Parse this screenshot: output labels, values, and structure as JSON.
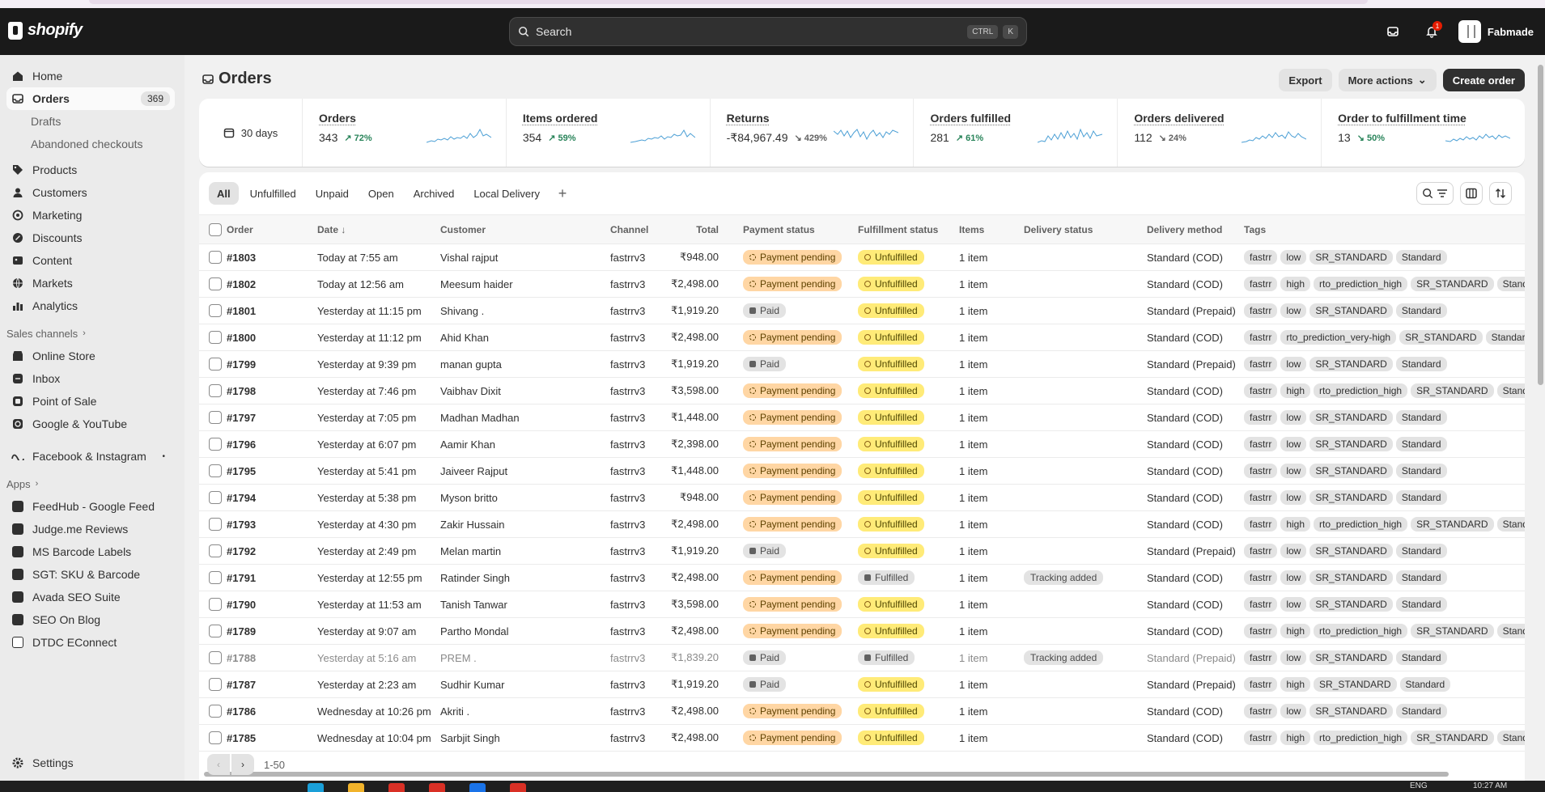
{
  "topbar": {
    "logo": "shopify",
    "search_placeholder": "Search",
    "kbd_ctrl": "CTRL",
    "kbd_k": "K",
    "notification_count": "1",
    "store_name": "Fabmade"
  },
  "sidebar": {
    "items": [
      {
        "label": "Home",
        "icon": "home-icon"
      },
      {
        "label": "Orders",
        "icon": "orders-icon",
        "count": "369"
      },
      {
        "label": "Products",
        "icon": "tag-icon"
      },
      {
        "label": "Customers",
        "icon": "person-icon"
      },
      {
        "label": "Marketing",
        "icon": "target-icon"
      },
      {
        "label": "Discounts",
        "icon": "discount-icon"
      },
      {
        "label": "Content",
        "icon": "content-icon"
      },
      {
        "label": "Markets",
        "icon": "globe-icon"
      },
      {
        "label": "Analytics",
        "icon": "chart-icon"
      }
    ],
    "orders_sub": [
      "Drafts",
      "Abandoned checkouts"
    ],
    "sales_channels_label": "Sales channels",
    "channels": [
      "Online Store",
      "Inbox",
      "Point of Sale",
      "Google & YouTube"
    ],
    "facebook": "Facebook & Instagram",
    "apps_label": "Apps",
    "apps": [
      "FeedHub - Google Feed",
      "Judge.me Reviews",
      "MS Barcode Labels",
      "SGT: SKU & Barcode",
      "Avada SEO Suite",
      "SEO On Blog",
      "DTDC EConnect"
    ],
    "settings": "Settings"
  },
  "page": {
    "title": "Orders",
    "export": "Export",
    "more_actions": "More actions",
    "create_order": "Create order"
  },
  "stats": {
    "range": "30 days",
    "cards": [
      {
        "title": "Orders",
        "value": "343",
        "delta": "72%",
        "dir": "up"
      },
      {
        "title": "Items ordered",
        "value": "354",
        "delta": "59%",
        "dir": "up"
      },
      {
        "title": "Returns",
        "value": "-₹84,967.49",
        "delta": "429%",
        "dir": "down"
      },
      {
        "title": "Orders fulfilled",
        "value": "281",
        "delta": "61%",
        "dir": "up"
      },
      {
        "title": "Orders delivered",
        "value": "112",
        "delta": "24%",
        "dir": "down"
      },
      {
        "title": "Order to fulfillment time",
        "value": "13",
        "delta": "50%",
        "dir": "down-green"
      }
    ]
  },
  "tabs": [
    "All",
    "Unfulfilled",
    "Unpaid",
    "Open",
    "Archived",
    "Local Delivery"
  ],
  "table": {
    "headers": [
      "Order",
      "Date ↓",
      "Customer",
      "Channel",
      "Total",
      "Payment status",
      "Fulfillment status",
      "Items",
      "Delivery status",
      "Delivery method",
      "Tags"
    ],
    "rows": [
      {
        "order": "#1803",
        "date": "Today at 7:55 am",
        "customer": "Vishal rajput",
        "channel": "fastrrv3",
        "total": "₹948.00",
        "payment": "Payment pending",
        "fulfillment": "Unfulfilled",
        "items": "1 item",
        "delivery": "",
        "method": "Standard (COD)",
        "tags": [
          "fastrr",
          "low",
          "SR_STANDARD",
          "Standard"
        ]
      },
      {
        "order": "#1802",
        "date": "Today at 12:56 am",
        "customer": "Meesum haider",
        "channel": "fastrrv3",
        "total": "₹2,498.00",
        "payment": "Payment pending",
        "fulfillment": "Unfulfilled",
        "items": "1 item",
        "delivery": "",
        "method": "Standard (COD)",
        "tags": [
          "fastrr",
          "high",
          "rto_prediction_high",
          "SR_STANDARD",
          "Standard"
        ]
      },
      {
        "order": "#1801",
        "date": "Yesterday at 11:15 pm",
        "customer": "Shivang .",
        "channel": "fastrrv3",
        "total": "₹1,919.20",
        "payment": "Paid",
        "fulfillment": "Unfulfilled",
        "items": "1 item",
        "delivery": "",
        "method": "Standard (Prepaid)",
        "tags": [
          "fastrr",
          "low",
          "SR_STANDARD",
          "Standard"
        ]
      },
      {
        "order": "#1800",
        "date": "Yesterday at 11:12 pm",
        "customer": "Ahid Khan",
        "channel": "fastrrv3",
        "total": "₹2,498.00",
        "payment": "Payment pending",
        "fulfillment": "Unfulfilled",
        "items": "1 item",
        "delivery": "",
        "method": "Standard (COD)",
        "tags": [
          "fastrr",
          "rto_prediction_very-high",
          "SR_STANDARD",
          "Standard"
        ]
      },
      {
        "order": "#1799",
        "date": "Yesterday at 9:39 pm",
        "customer": "manan gupta",
        "channel": "fastrrv3",
        "total": "₹1,919.20",
        "payment": "Paid",
        "fulfillment": "Unfulfilled",
        "items": "1 item",
        "delivery": "",
        "method": "Standard (Prepaid)",
        "tags": [
          "fastrr",
          "low",
          "SR_STANDARD",
          "Standard"
        ]
      },
      {
        "order": "#1798",
        "date": "Yesterday at 7:46 pm",
        "customer": "Vaibhav Dixit",
        "channel": "fastrrv3",
        "total": "₹3,598.00",
        "payment": "Payment pending",
        "fulfillment": "Unfulfilled",
        "items": "1 item",
        "delivery": "",
        "method": "Standard (COD)",
        "tags": [
          "fastrr",
          "high",
          "rto_prediction_high",
          "SR_STANDARD",
          "Standard"
        ]
      },
      {
        "order": "#1797",
        "date": "Yesterday at 7:05 pm",
        "customer": "Madhan Madhan",
        "channel": "fastrrv3",
        "total": "₹1,448.00",
        "payment": "Payment pending",
        "fulfillment": "Unfulfilled",
        "items": "1 item",
        "delivery": "",
        "method": "Standard (COD)",
        "tags": [
          "fastrr",
          "low",
          "SR_STANDARD",
          "Standard"
        ]
      },
      {
        "order": "#1796",
        "date": "Yesterday at 6:07 pm",
        "customer": "Aamir Khan",
        "channel": "fastrrv3",
        "total": "₹2,398.00",
        "payment": "Payment pending",
        "fulfillment": "Unfulfilled",
        "items": "1 item",
        "delivery": "",
        "method": "Standard (COD)",
        "tags": [
          "fastrr",
          "low",
          "SR_STANDARD",
          "Standard"
        ]
      },
      {
        "order": "#1795",
        "date": "Yesterday at 5:41 pm",
        "customer": "Jaiveer Rajput",
        "channel": "fastrrv3",
        "total": "₹1,448.00",
        "payment": "Payment pending",
        "fulfillment": "Unfulfilled",
        "items": "1 item",
        "delivery": "",
        "method": "Standard (COD)",
        "tags": [
          "fastrr",
          "low",
          "SR_STANDARD",
          "Standard"
        ]
      },
      {
        "order": "#1794",
        "date": "Yesterday at 5:38 pm",
        "customer": "Myson britto",
        "channel": "fastrrv3",
        "total": "₹948.00",
        "payment": "Payment pending",
        "fulfillment": "Unfulfilled",
        "items": "1 item",
        "delivery": "",
        "method": "Standard (COD)",
        "tags": [
          "fastrr",
          "low",
          "SR_STANDARD",
          "Standard"
        ]
      },
      {
        "order": "#1793",
        "date": "Yesterday at 4:30 pm",
        "customer": "Zakir Hussain",
        "channel": "fastrrv3",
        "total": "₹2,498.00",
        "payment": "Payment pending",
        "fulfillment": "Unfulfilled",
        "items": "1 item",
        "delivery": "",
        "method": "Standard (COD)",
        "tags": [
          "fastrr",
          "high",
          "rto_prediction_high",
          "SR_STANDARD",
          "Standard"
        ]
      },
      {
        "order": "#1792",
        "date": "Yesterday at 2:49 pm",
        "customer": "Melan martin",
        "channel": "fastrrv3",
        "total": "₹1,919.20",
        "payment": "Paid",
        "fulfillment": "Unfulfilled",
        "items": "1 item",
        "delivery": "",
        "method": "Standard (Prepaid)",
        "tags": [
          "fastrr",
          "low",
          "SR_STANDARD",
          "Standard"
        ]
      },
      {
        "order": "#1791",
        "date": "Yesterday at 12:55 pm",
        "customer": "Ratinder Singh",
        "channel": "fastrrv3",
        "total": "₹2,498.00",
        "payment": "Payment pending",
        "fulfillment": "Fulfilled",
        "items": "1 item",
        "delivery": "Tracking added",
        "method": "Standard (COD)",
        "tags": [
          "fastrr",
          "low",
          "SR_STANDARD",
          "Standard"
        ]
      },
      {
        "order": "#1790",
        "date": "Yesterday at 11:53 am",
        "customer": "Tanish Tanwar",
        "channel": "fastrrv3",
        "total": "₹3,598.00",
        "payment": "Payment pending",
        "fulfillment": "Unfulfilled",
        "items": "1 item",
        "delivery": "",
        "method": "Standard (COD)",
        "tags": [
          "fastrr",
          "low",
          "SR_STANDARD",
          "Standard"
        ]
      },
      {
        "order": "#1789",
        "date": "Yesterday at 9:07 am",
        "customer": "Partho Mondal",
        "channel": "fastrrv3",
        "total": "₹2,498.00",
        "payment": "Payment pending",
        "fulfillment": "Unfulfilled",
        "items": "1 item",
        "delivery": "",
        "method": "Standard (COD)",
        "tags": [
          "fastrr",
          "high",
          "rto_prediction_high",
          "SR_STANDARD",
          "Standard"
        ]
      },
      {
        "order": "#1788",
        "date": "Yesterday at 5:16 am",
        "customer": "PREM .",
        "channel": "fastrrv3",
        "total": "₹1,839.20",
        "payment": "Paid",
        "fulfillment": "Fulfilled",
        "items": "1 item",
        "delivery": "Tracking added",
        "method": "Standard (Prepaid)",
        "tags": [
          "fastrr",
          "low",
          "SR_STANDARD",
          "Standard"
        ],
        "faded": true
      },
      {
        "order": "#1787",
        "date": "Yesterday at 2:23 am",
        "customer": "Sudhir Kumar",
        "channel": "fastrrv3",
        "total": "₹1,919.20",
        "payment": "Paid",
        "fulfillment": "Unfulfilled",
        "items": "1 item",
        "delivery": "",
        "method": "Standard (Prepaid)",
        "tags": [
          "fastrr",
          "high",
          "SR_STANDARD",
          "Standard"
        ]
      },
      {
        "order": "#1786",
        "date": "Wednesday at 10:26 pm",
        "customer": "Akriti .",
        "channel": "fastrrv3",
        "total": "₹2,498.00",
        "payment": "Payment pending",
        "fulfillment": "Unfulfilled",
        "items": "1 item",
        "delivery": "",
        "method": "Standard (COD)",
        "tags": [
          "fastrr",
          "low",
          "SR_STANDARD",
          "Standard"
        ]
      },
      {
        "order": "#1785",
        "date": "Wednesday at 10:04 pm",
        "customer": "Sarbjit Singh",
        "channel": "fastrrv3",
        "total": "₹2,498.00",
        "payment": "Payment pending",
        "fulfillment": "Unfulfilled",
        "items": "1 item",
        "delivery": "",
        "method": "Standard (COD)",
        "tags": [
          "fastrr",
          "high",
          "rto_prediction_high",
          "SR_STANDARD",
          "Standard"
        ]
      }
    ]
  },
  "pagination": {
    "range": "1-50"
  },
  "taskbar": {
    "lang": "ENG",
    "time": "10:27 AM"
  },
  "colors": {
    "topbar": "#1a1a1a",
    "pending": "#ffd6a4",
    "unfulfilled": "#ffeb78",
    "positive": "#29845a"
  }
}
